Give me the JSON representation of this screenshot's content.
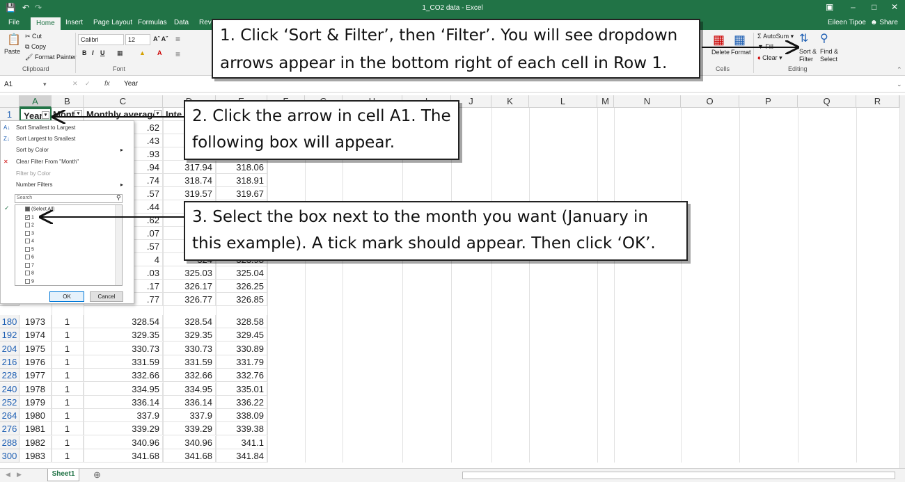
{
  "window": {
    "title": "1_CO2 data - Excel",
    "user": "Eileen Tipoe",
    "share": "Share"
  },
  "tabs": [
    "File",
    "Home",
    "Insert",
    "Page Layout",
    "Formulas",
    "Data",
    "Rev"
  ],
  "ribbon": {
    "clipboard": {
      "cut": "Cut",
      "copy": "Copy",
      "paste": "Paste",
      "format_painter": "Format Painter",
      "label": "Clipboard"
    },
    "font": {
      "name": "Calibri",
      "size": "12",
      "label": "Font"
    },
    "cells": {
      "delete": "Delete",
      "format": "Format",
      "label": "Cells"
    },
    "editing": {
      "autosum": "AutoSum",
      "fill": "Fill",
      "clear": "Clear",
      "sort_filter": "Sort &\nFilter",
      "find_select": "Find &\nSelect",
      "label": "Editing"
    }
  },
  "formula_bar": {
    "name_box": "A1",
    "fx": "fx",
    "content": "Year"
  },
  "columns": [
    "A",
    "B",
    "C",
    "D",
    "E",
    "F",
    "G",
    "H",
    "I",
    "J",
    "K",
    "L",
    "M",
    "N",
    "O",
    "P",
    "Q",
    "R"
  ],
  "header_row": {
    "row": "1",
    "a": "Year",
    "b": "Month",
    "c": "Monthly average",
    "d": "Inte"
  },
  "visible_partial_rows": [
    {
      "c": ".62",
      "d": "3"
    },
    {
      "c": ".43",
      "d": "3"
    },
    {
      "c": ".93",
      "d": "3"
    },
    {
      "c": ".94",
      "d": "317.94",
      "e": "318.06"
    },
    {
      "c": ".74",
      "d": "318.74",
      "e": "318.91"
    },
    {
      "c": ".57",
      "d": "319.57",
      "e": "319.67"
    },
    {
      "c": ".44",
      "d": "3"
    },
    {
      "c": ".62",
      "d": "3"
    },
    {
      "c": ".07",
      "d": "3"
    },
    {
      "c": ".57",
      "d": "3"
    },
    {
      "c": "4",
      "d": "324",
      "e": "323.98"
    },
    {
      "c": ".03",
      "d": "325.03",
      "e": "325.04"
    },
    {
      "c": ".17",
      "d": "326.17",
      "e": "326.25"
    },
    {
      "c": ".77",
      "d": "326.77",
      "e": "326.85"
    }
  ],
  "rows": [
    {
      "row": "180",
      "year": "1973",
      "month": "1",
      "c": "328.54",
      "d": "328.54",
      "e": "328.58"
    },
    {
      "row": "192",
      "year": "1974",
      "month": "1",
      "c": "329.35",
      "d": "329.35",
      "e": "329.45"
    },
    {
      "row": "204",
      "year": "1975",
      "month": "1",
      "c": "330.73",
      "d": "330.73",
      "e": "330.89"
    },
    {
      "row": "216",
      "year": "1976",
      "month": "1",
      "c": "331.59",
      "d": "331.59",
      "e": "331.79"
    },
    {
      "row": "228",
      "year": "1977",
      "month": "1",
      "c": "332.66",
      "d": "332.66",
      "e": "332.76"
    },
    {
      "row": "240",
      "year": "1978",
      "month": "1",
      "c": "334.95",
      "d": "334.95",
      "e": "335.01"
    },
    {
      "row": "252",
      "year": "1979",
      "month": "1",
      "c": "336.14",
      "d": "336.14",
      "e": "336.22"
    },
    {
      "row": "264",
      "year": "1980",
      "month": "1",
      "c": "337.9",
      "d": "337.9",
      "e": "338.09"
    },
    {
      "row": "276",
      "year": "1981",
      "month": "1",
      "c": "339.29",
      "d": "339.29",
      "e": "339.38"
    },
    {
      "row": "288",
      "year": "1982",
      "month": "1",
      "c": "340.96",
      "d": "340.96",
      "e": "341.1"
    },
    {
      "row": "300",
      "year": "1983",
      "month": "1",
      "c": "341.68",
      "d": "341.68",
      "e": "341.84"
    }
  ],
  "filter_panel": {
    "menu": [
      "Sort Smallest to Largest",
      "Sort Largest to Smallest",
      "Sort by Color",
      "Clear Filter From \"Month\"",
      "Filter by Color",
      "Number Filters"
    ],
    "search_placeholder": "Search",
    "list": [
      "(Select All)",
      "1",
      "2",
      "3",
      "4",
      "5",
      "6",
      "7",
      "8",
      "9"
    ],
    "ok": "OK",
    "cancel": "Cancel"
  },
  "callouts": {
    "c1": "1. Click ‘Sort & Filter’, then ‘Filter’. You will see dropdown arrows appear in the bottom right of each cell in Row 1.",
    "c2": "2. Click the arrow in cell A1. The following box will appear.",
    "c3": "3. Select the box next to the month you want (January in this example). A tick mark should appear. Then click ‘OK’."
  },
  "sheet_tab": "Sheet1",
  "colors": {
    "excel_green": "#217346",
    "row_header_blue": "#1e5fb3"
  }
}
